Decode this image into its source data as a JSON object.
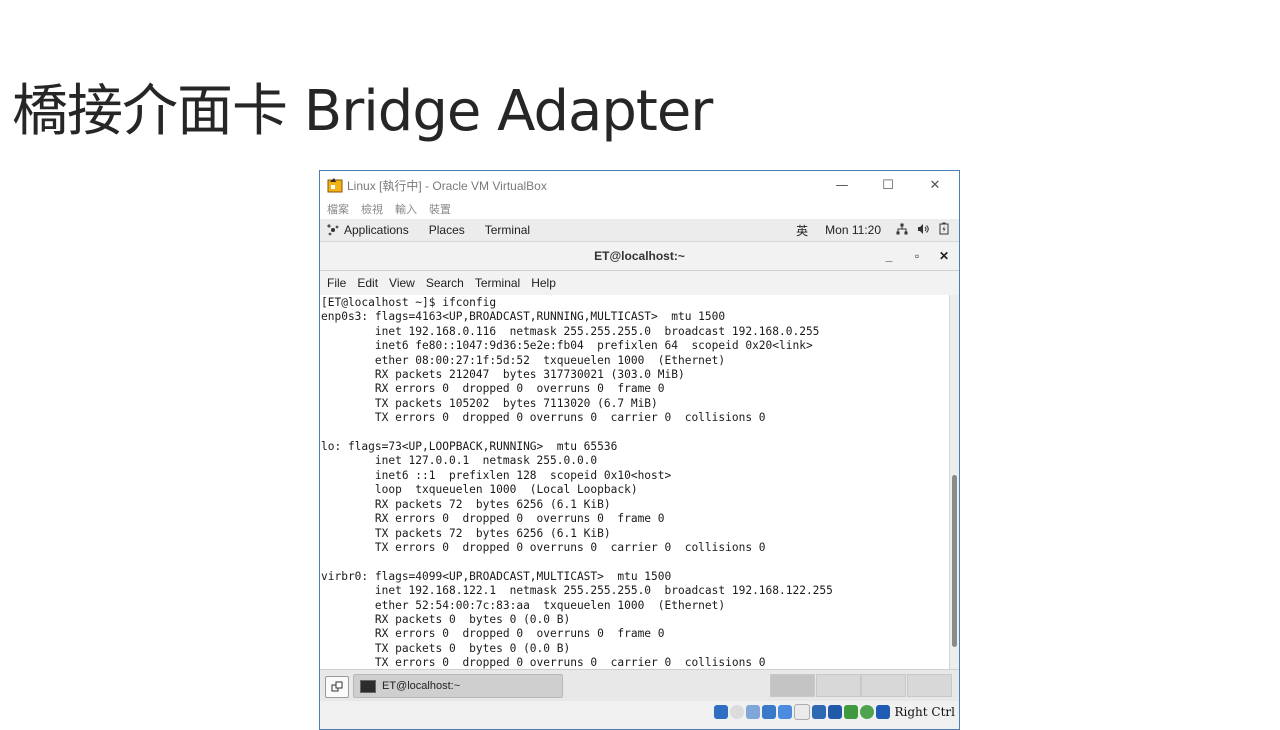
{
  "slide": {
    "title": "橋接介面卡 Bridge Adapter"
  },
  "vbox": {
    "window_title": "Linux [執行中] - Oracle VM VirtualBox",
    "menu": [
      "檔案",
      "檢視",
      "輸入",
      "裝置"
    ],
    "controls": {
      "minimize": "—",
      "maximize": "☐",
      "close": "✕"
    }
  },
  "gnome_bar": {
    "applications": "Applications",
    "places": "Places",
    "terminal": "Terminal",
    "input_method": "英",
    "clock": "Mon 11:20"
  },
  "terminal": {
    "title": "ET@localhost:~",
    "buttons": {
      "minimize": "_",
      "maximize": "▫",
      "close": "✕"
    },
    "menu": [
      "File",
      "Edit",
      "View",
      "Search",
      "Terminal",
      "Help"
    ],
    "output": "[ET@localhost ~]$ ifconfig\nenp0s3: flags=4163<UP,BROADCAST,RUNNING,MULTICAST>  mtu 1500\n        inet 192.168.0.116  netmask 255.255.255.0  broadcast 192.168.0.255\n        inet6 fe80::1047:9d36:5e2e:fb04  prefixlen 64  scopeid 0x20<link>\n        ether 08:00:27:1f:5d:52  txqueuelen 1000  (Ethernet)\n        RX packets 212047  bytes 317730021 (303.0 MiB)\n        RX errors 0  dropped 0  overruns 0  frame 0\n        TX packets 105202  bytes 7113020 (6.7 MiB)\n        TX errors 0  dropped 0 overruns 0  carrier 0  collisions 0\n\nlo: flags=73<UP,LOOPBACK,RUNNING>  mtu 65536\n        inet 127.0.0.1  netmask 255.0.0.0\n        inet6 ::1  prefixlen 128  scopeid 0x10<host>\n        loop  txqueuelen 1000  (Local Loopback)\n        RX packets 72  bytes 6256 (6.1 KiB)\n        RX errors 0  dropped 0  overruns 0  frame 0\n        TX packets 72  bytes 6256 (6.1 KiB)\n        TX errors 0  dropped 0 overruns 0  carrier 0  collisions 0\n\nvirbr0: flags=4099<UP,BROADCAST,MULTICAST>  mtu 1500\n        inet 192.168.122.1  netmask 255.255.255.0  broadcast 192.168.122.255\n        ether 52:54:00:7c:83:aa  txqueuelen 1000  (Ethernet)\n        RX packets 0  bytes 0 (0.0 B)\n        RX errors 0  dropped 0  overruns 0  frame 0\n        TX packets 0  bytes 0 (0.0 B)\n        TX errors 0  dropped 0 overruns 0  carrier 0  collisions 0"
  },
  "taskbar": {
    "task_label": "ET@localhost:~"
  },
  "statusbar": {
    "host_key": "Right Ctrl"
  }
}
